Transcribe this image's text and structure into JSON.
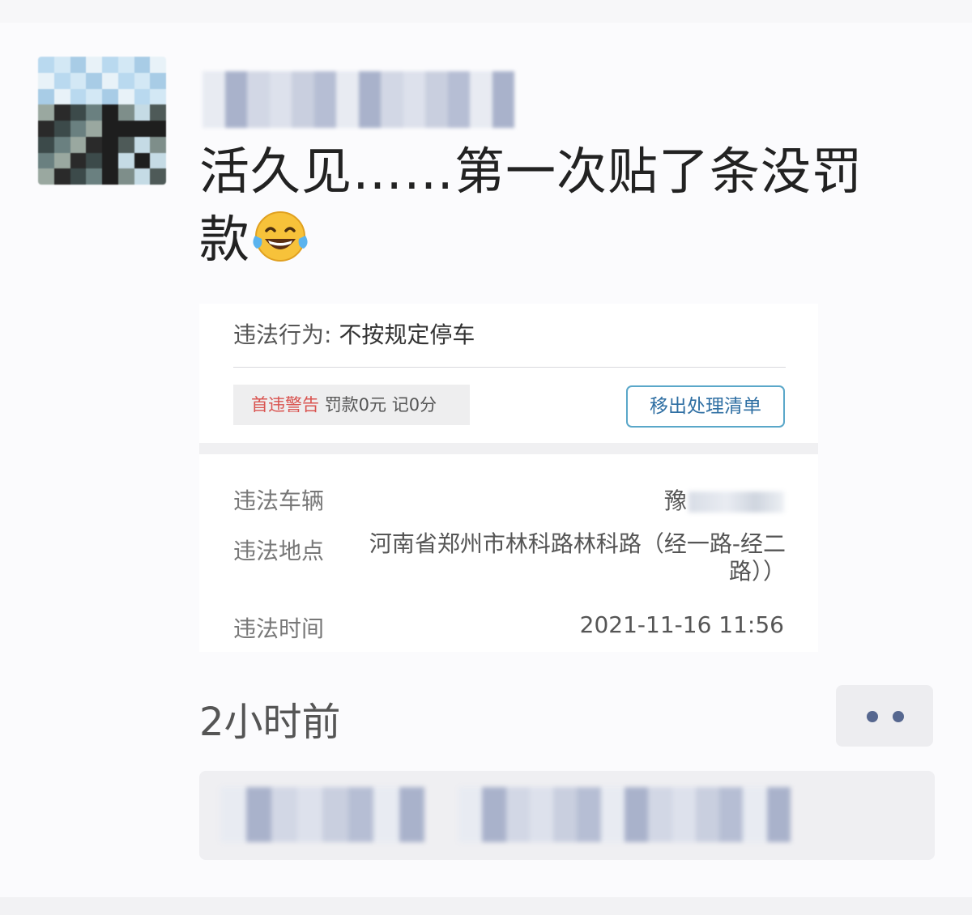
{
  "post": {
    "text": "活久见……第一次贴了条没罚款",
    "emoji_icon": "laughing-tears-icon",
    "time_ago": "2小时前"
  },
  "ticket": {
    "behavior_label": "违法行为:",
    "behavior_value": "不按规定停车",
    "penalty_warning": "首违警告",
    "penalty_detail": "罚款0元 记0分",
    "remove_button_label": "移出处理清单",
    "vehicle_label": "违法车辆",
    "vehicle_value": "豫",
    "location_label": "违法地点",
    "location_value": "河南省郑州市林科路林科路（经一路-经二路））",
    "time_label": "违法时间",
    "time_value": "2021-11-16 11:56"
  },
  "colors": {
    "warning_red": "#d9534f",
    "button_border": "#5aa7c9",
    "button_text": "#2f6fa3",
    "more_dots": "#56678f"
  }
}
